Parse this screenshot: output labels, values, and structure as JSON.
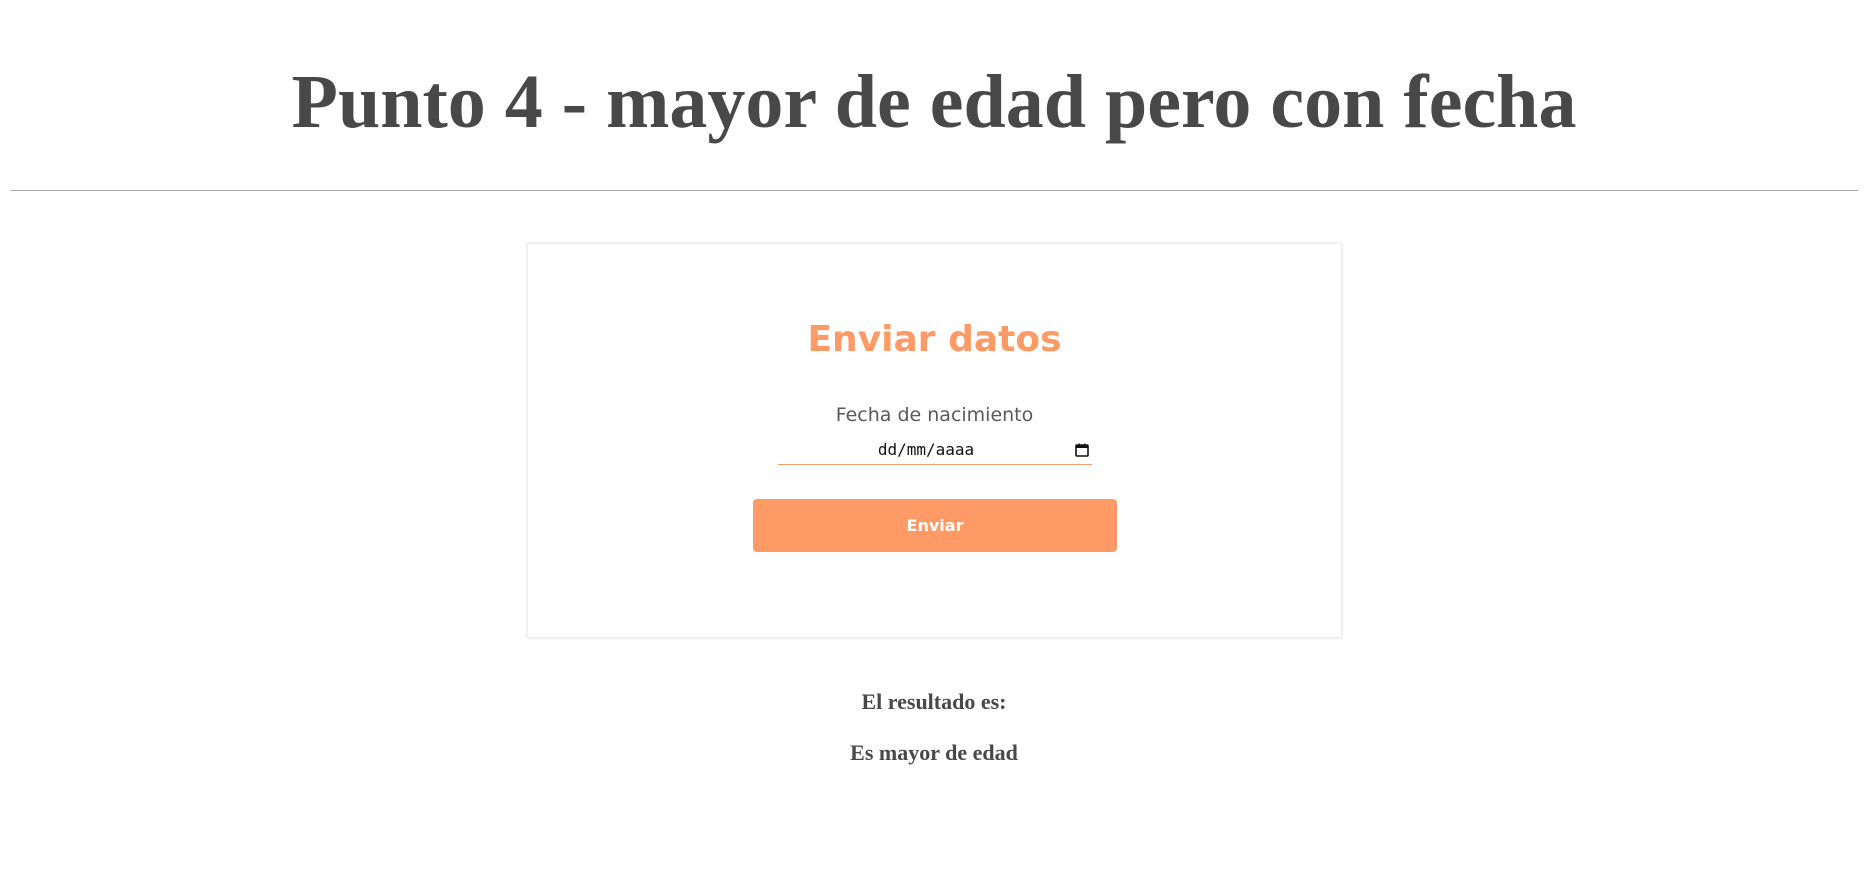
{
  "page": {
    "title": "Punto 4 - mayor de edad pero con fecha"
  },
  "form": {
    "title": "Enviar datos",
    "birthdate_label": "Fecha de nacimiento",
    "birthdate_placeholder": "dd/mm/aaaa",
    "submit_label": "Enviar"
  },
  "result": {
    "label": "El resultado es:",
    "value": "Es mayor de edad"
  },
  "icons": {
    "date_picker": "calendar-icon"
  },
  "colors": {
    "accent": "#fe9a65",
    "text": "#484848",
    "divider": "#a8a8a8"
  }
}
